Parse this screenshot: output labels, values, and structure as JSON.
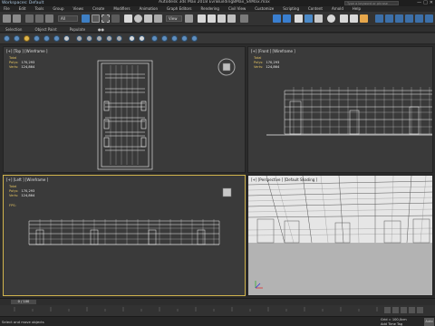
{
  "titlebar": {
    "workspace": "Workspaces: Default",
    "app_title": "Autodesk 3ds Max 2018    EvnBuilding8Max_ShMax.max",
    "search_placeholder": "Type a keyword or phrase",
    "window_buttons": [
      "—",
      "□",
      "✕"
    ]
  },
  "menubar": {
    "items": [
      "File",
      "Edit",
      "Tools",
      "Group",
      "Views",
      "Create",
      "Modifiers",
      "Animation",
      "Graph Editors",
      "Rendering",
      "Civil View",
      "Customize",
      "Scripting",
      "Content",
      "Arnold",
      "Help"
    ]
  },
  "toolbar": {
    "selection_filter": "All",
    "view_dropdown": "View",
    "icons": [
      "undo-icon",
      "redo-icon",
      "link-icon",
      "unlink-icon",
      "bind-icon",
      "select-icon",
      "select-by-name-icon",
      "rect-select-icon",
      "window-crossing-icon",
      "move-icon",
      "rotate-icon",
      "scale-icon",
      "placement-icon",
      "coord-icon",
      "pivot-icon",
      "snap-icon",
      "angle-snap-icon",
      "percent-snap-icon",
      "spinner-snap-icon",
      "named-sets-icon",
      "mirror-icon",
      "align-icon",
      "layer-icon",
      "curve-editor-icon",
      "schematic-icon",
      "material-editor-icon",
      "render-setup-icon",
      "rendered-frame-icon",
      "render-icon"
    ]
  },
  "ribbon": {
    "tabs": [
      "Selection",
      "Object Paint",
      "Populate",
      "●●"
    ]
  },
  "viewports": {
    "top": {
      "label": "[+] [Top ] [Wireframe ]",
      "stats": {
        "total_label": "Total",
        "polys_label": "Polys:",
        "polys_value": "170,293",
        "verts_label": "Verts:",
        "verts_value": "124,864"
      }
    },
    "front": {
      "label": "[+] [Front ] [Wireframe ]",
      "stats": {
        "total_label": "Total",
        "polys_label": "Polys:",
        "polys_value": "170,293",
        "verts_label": "Verts:",
        "verts_value": "124,864"
      }
    },
    "left": {
      "label": "[+] [Left ] [Wireframe ]",
      "stats": {
        "total_label": "Total",
        "polys_label": "Polys:",
        "polys_value": "170,293",
        "verts_label": "Verts:",
        "verts_value": "124,864"
      },
      "fps_label": "FPS:"
    },
    "perspective": {
      "label": "[+] [Perspective ] [Default Shading ]"
    }
  },
  "timeline": {
    "frame_counter": "0 / 100"
  },
  "trackbar": {
    "ticks": [
      "0",
      "5",
      "10",
      "15",
      "20",
      "25",
      "30",
      "35",
      "40",
      "45",
      "50",
      "55",
      "60",
      "65",
      "70",
      "75",
      "80",
      "85",
      "90",
      "95",
      "100"
    ]
  },
  "statusbar": {
    "status_text": "Select and move objects",
    "grid_text": "Grid = 100,0cm",
    "add_time_tag": "Add Time Tag",
    "auto_key": "Auto"
  },
  "colors": {
    "viewport_bg": "#3a3a3a",
    "wire_color": "#f2f2f2",
    "active_border": "#d1b44d",
    "stats_color": "#e0c060"
  }
}
